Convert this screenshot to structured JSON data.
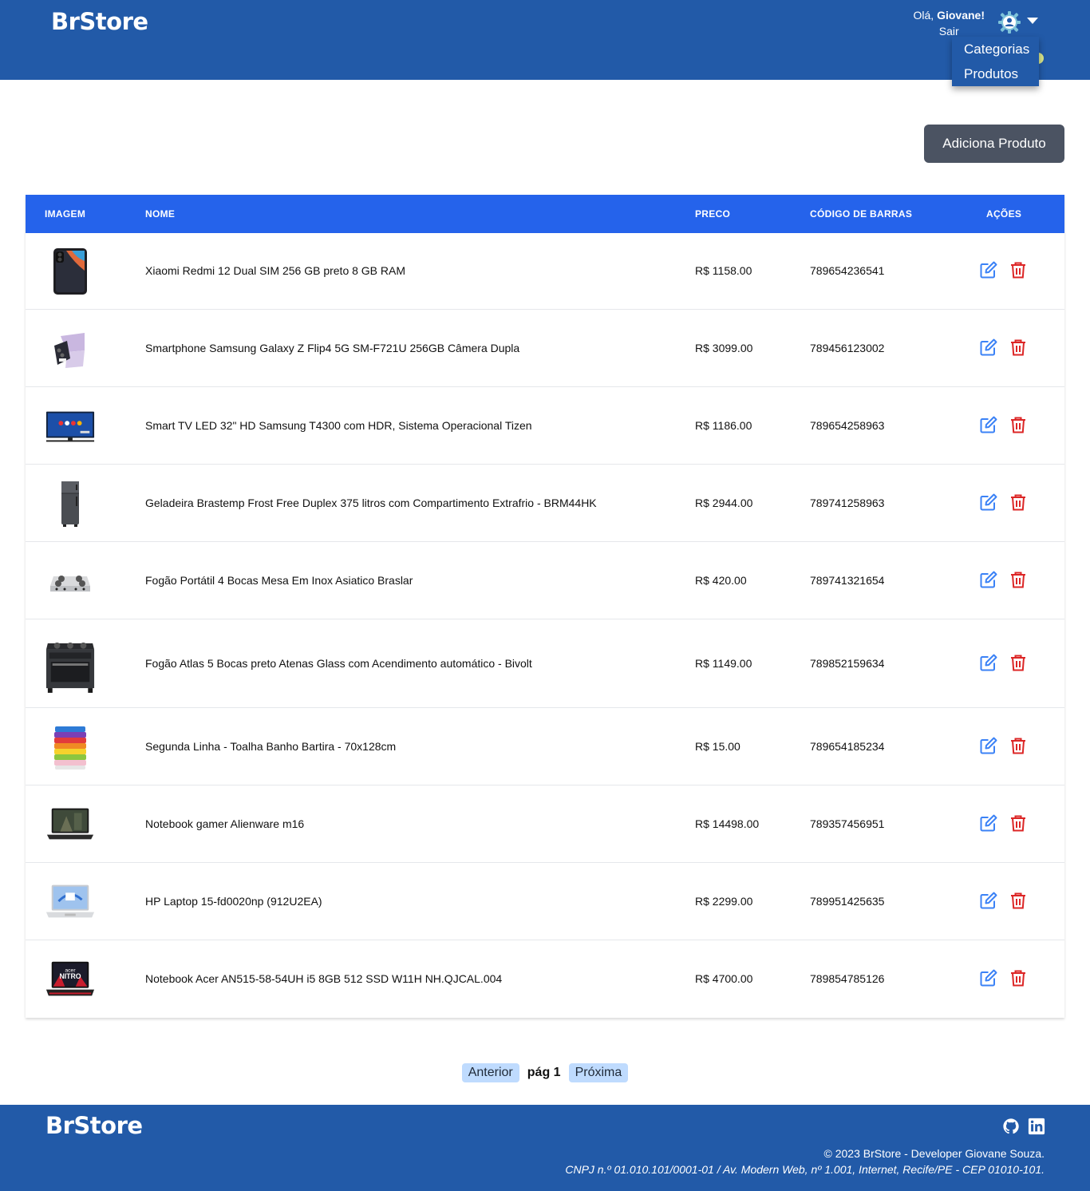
{
  "header": {
    "brand": "BrStore",
    "greeting_prefix": "Olá, ",
    "user_name": "Giovane!",
    "logout": "Sair",
    "menu": [
      {
        "label": "Categorias"
      },
      {
        "label": "Produtos"
      }
    ]
  },
  "actions": {
    "add_product": "Adiciona Produto"
  },
  "table": {
    "columns": {
      "image": "IMAGEM",
      "name": "NOME",
      "price": "PRECO",
      "barcode": "CÓDIGO DE BARRAS",
      "actions": "AÇÕES"
    },
    "rows": [
      {
        "image": "phone-black",
        "name": "Xiaomi Redmi 12 Dual SIM 256 GB preto 8 GB RAM",
        "price": "R$ 1158.00",
        "barcode": "789654236541"
      },
      {
        "image": "phone-flip",
        "name": "Smartphone Samsung Galaxy Z Flip4 5G SM-F721U 256GB Câmera Dupla",
        "price": "R$ 3099.00",
        "barcode": "789456123002"
      },
      {
        "image": "tv",
        "name": "Smart TV LED 32\" HD Samsung T4300 com HDR, Sistema Operacional Tizen",
        "price": "R$ 1186.00",
        "barcode": "789654258963"
      },
      {
        "image": "fridge",
        "name": "Geladeira Brastemp Frost Free Duplex 375 litros com Compartimento Extrafrio - BRM44HK",
        "price": "R$ 2944.00",
        "barcode": "789741258963"
      },
      {
        "image": "cooktop",
        "name": "Fogão Portátil 4 Bocas Mesa Em Inox Asiatico Braslar",
        "price": "R$ 420.00",
        "barcode": "789741321654"
      },
      {
        "image": "stove",
        "name": "Fogão Atlas 5 Bocas preto Atenas Glass com Acendimento automático - Bivolt",
        "price": "R$ 1149.00",
        "barcode": "789852159634"
      },
      {
        "image": "towels",
        "name": "Segunda Linha - Toalha Banho Bartira - 70x128cm",
        "price": "R$ 15.00",
        "barcode": "789654185234"
      },
      {
        "image": "laptop-dark",
        "name": "Notebook gamer Alienware m16",
        "price": "R$ 14498.00",
        "barcode": "789357456951"
      },
      {
        "image": "laptop-silver",
        "name": "HP Laptop 15-fd0020np (912U2EA)",
        "price": "R$ 2299.00",
        "barcode": "789951425635"
      },
      {
        "image": "laptop-acer",
        "name": "Notebook Acer AN515-58-54UH i5 8GB 512 SSD W11H NH.QJCAL.004",
        "price": "R$ 4700.00",
        "barcode": "789854785126",
        "image_text": "NITRO"
      }
    ]
  },
  "pagination": {
    "prev": "Anterior",
    "page_label": "pág 1",
    "next": "Próxima"
  },
  "footer": {
    "brand": "BrStore",
    "copyright": "© 2023 BrStore - Developer Giovane Souza.",
    "address": "CNPJ n.º 01.010.101/0001-01 / Av. Modern Web, nº 1.001, Internet, Recife/PE - CEP 01010-101.",
    "icons": [
      "github-icon",
      "linkedin-icon"
    ]
  },
  "colors": {
    "header_bg": "#225aa8",
    "table_header_bg": "#2563eb",
    "add_button_bg": "#4b5362",
    "edit_icon": "#3b82f6",
    "delete_icon": "#dc2626",
    "pager_button_bg": "#bfdbfe"
  }
}
